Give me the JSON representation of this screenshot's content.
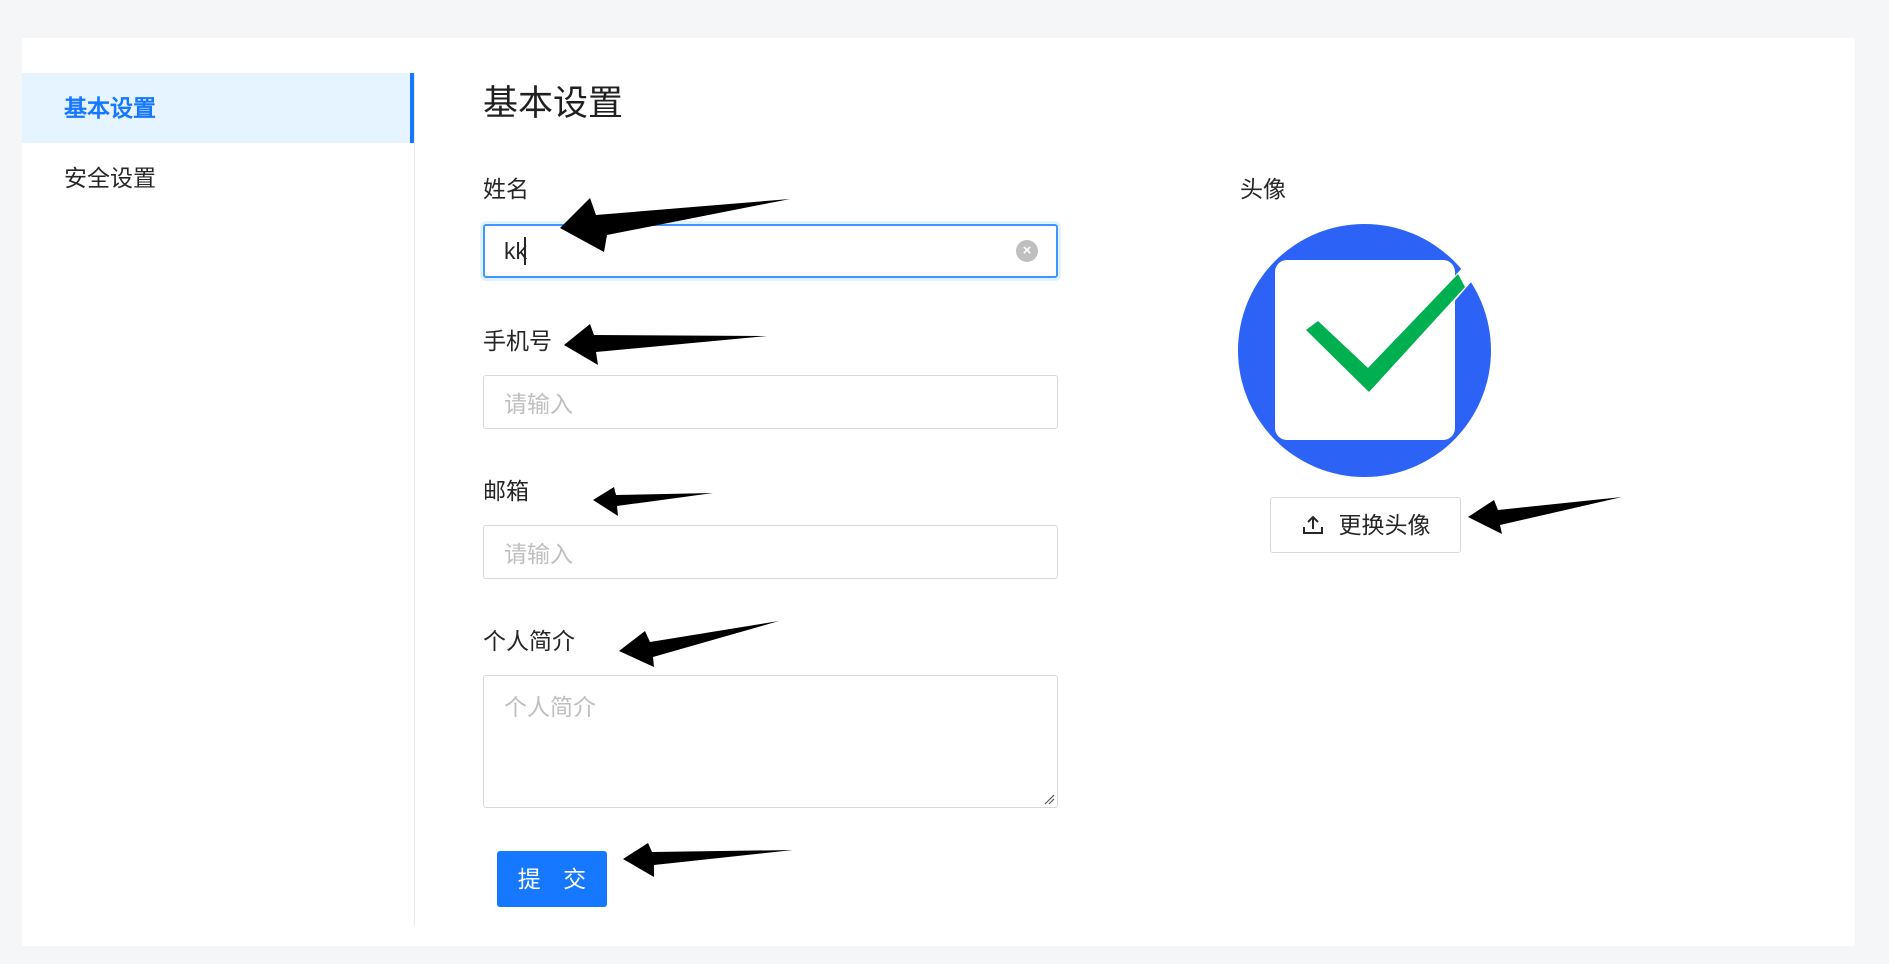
{
  "sidebar": {
    "items": [
      {
        "label": "基本设置",
        "active": true
      },
      {
        "label": "安全设置",
        "active": false
      }
    ]
  },
  "main": {
    "title": "基本设置",
    "fields": {
      "name": {
        "label": "姓名",
        "value": "kk"
      },
      "phone": {
        "label": "手机号",
        "placeholder": "请输入"
      },
      "email": {
        "label": "邮箱",
        "placeholder": "请输入"
      },
      "bio": {
        "label": "个人简介",
        "placeholder": "个人简介"
      }
    },
    "submit_label": "提 交"
  },
  "avatar": {
    "label": "头像",
    "upload_label": "更换头像",
    "icon": "checkmark-logo"
  },
  "colors": {
    "accent": "#1677ff",
    "avatar_bg": "#2d62f6",
    "check": "#00b050"
  }
}
